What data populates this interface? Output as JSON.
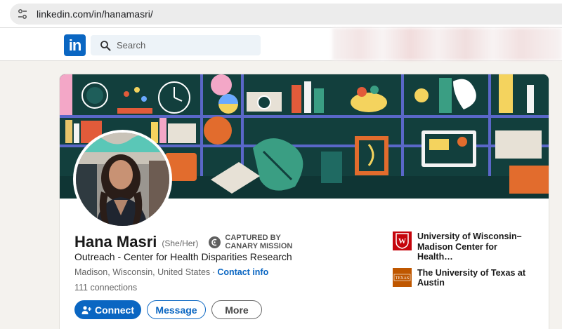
{
  "browser": {
    "url": "linkedin.com/in/hanamasri/",
    "site_icon": "tune-icon"
  },
  "header": {
    "logo_text": "in",
    "search_placeholder": "Search"
  },
  "profile": {
    "name": "Hana Masri",
    "pronouns": "(She/Her)",
    "badge_line1": "CAPTURED BY",
    "badge_line2": "CANARY MISSION",
    "headline": "Outreach - Center for Health Disparities Research",
    "location": "Madison, Wisconsin, United States",
    "separator": "·",
    "contact_link": "Contact info",
    "connections": "111 connections"
  },
  "actions": {
    "connect": "Connect",
    "message": "Message",
    "more": "More"
  },
  "education": [
    {
      "name": "University of Wisconsin–Madison Center for Health…",
      "logo": "uw-crest-icon"
    },
    {
      "name": "The University of Texas at Austin",
      "logo": "ut-logo-icon"
    }
  ],
  "colors": {
    "linkedin_blue": "#0a66c2",
    "banner_bg": "#0e3b3a",
    "uw_red": "#c5050c",
    "ut_orange": "#bf5700"
  }
}
